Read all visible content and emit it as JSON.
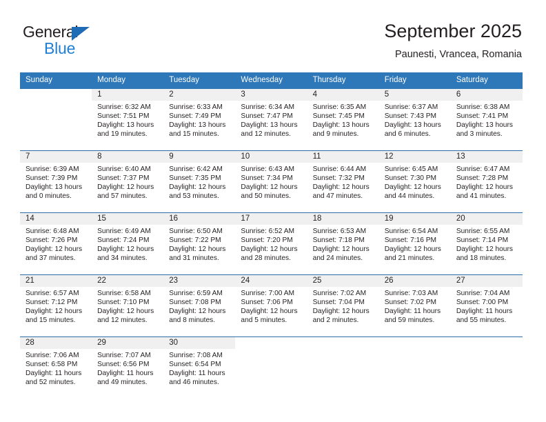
{
  "brand": {
    "name_top": "General",
    "name_bottom": "Blue",
    "triangle_color": "#1e6cb5",
    "blue_color": "#1f7fd4"
  },
  "header": {
    "title": "September 2025",
    "subtitle": "Paunesti, Vrancea, Romania"
  },
  "theme": {
    "header_blue": "#2e77b8",
    "row_divider": "#2b6ca8",
    "daynum_band": "#f0f0f0",
    "text": "#231f20"
  },
  "columns": [
    "Sunday",
    "Monday",
    "Tuesday",
    "Wednesday",
    "Thursday",
    "Friday",
    "Saturday"
  ],
  "labels": {
    "sunrise": "Sunrise:",
    "sunset": "Sunset:",
    "daylight": "Daylight:"
  },
  "weeks": [
    [
      {
        "day": "",
        "sunrise": "",
        "sunset": "",
        "daylight": ""
      },
      {
        "day": "1",
        "sunrise": "Sunrise: 6:32 AM",
        "sunset": "Sunset: 7:51 PM",
        "daylight": "Daylight: 13 hours and 19 minutes."
      },
      {
        "day": "2",
        "sunrise": "Sunrise: 6:33 AM",
        "sunset": "Sunset: 7:49 PM",
        "daylight": "Daylight: 13 hours and 15 minutes."
      },
      {
        "day": "3",
        "sunrise": "Sunrise: 6:34 AM",
        "sunset": "Sunset: 7:47 PM",
        "daylight": "Daylight: 13 hours and 12 minutes."
      },
      {
        "day": "4",
        "sunrise": "Sunrise: 6:35 AM",
        "sunset": "Sunset: 7:45 PM",
        "daylight": "Daylight: 13 hours and 9 minutes."
      },
      {
        "day": "5",
        "sunrise": "Sunrise: 6:37 AM",
        "sunset": "Sunset: 7:43 PM",
        "daylight": "Daylight: 13 hours and 6 minutes."
      },
      {
        "day": "6",
        "sunrise": "Sunrise: 6:38 AM",
        "sunset": "Sunset: 7:41 PM",
        "daylight": "Daylight: 13 hours and 3 minutes."
      }
    ],
    [
      {
        "day": "7",
        "sunrise": "Sunrise: 6:39 AM",
        "sunset": "Sunset: 7:39 PM",
        "daylight": "Daylight: 13 hours and 0 minutes."
      },
      {
        "day": "8",
        "sunrise": "Sunrise: 6:40 AM",
        "sunset": "Sunset: 7:37 PM",
        "daylight": "Daylight: 12 hours and 57 minutes."
      },
      {
        "day": "9",
        "sunrise": "Sunrise: 6:42 AM",
        "sunset": "Sunset: 7:35 PM",
        "daylight": "Daylight: 12 hours and 53 minutes."
      },
      {
        "day": "10",
        "sunrise": "Sunrise: 6:43 AM",
        "sunset": "Sunset: 7:34 PM",
        "daylight": "Daylight: 12 hours and 50 minutes."
      },
      {
        "day": "11",
        "sunrise": "Sunrise: 6:44 AM",
        "sunset": "Sunset: 7:32 PM",
        "daylight": "Daylight: 12 hours and 47 minutes."
      },
      {
        "day": "12",
        "sunrise": "Sunrise: 6:45 AM",
        "sunset": "Sunset: 7:30 PM",
        "daylight": "Daylight: 12 hours and 44 minutes."
      },
      {
        "day": "13",
        "sunrise": "Sunrise: 6:47 AM",
        "sunset": "Sunset: 7:28 PM",
        "daylight": "Daylight: 12 hours and 41 minutes."
      }
    ],
    [
      {
        "day": "14",
        "sunrise": "Sunrise: 6:48 AM",
        "sunset": "Sunset: 7:26 PM",
        "daylight": "Daylight: 12 hours and 37 minutes."
      },
      {
        "day": "15",
        "sunrise": "Sunrise: 6:49 AM",
        "sunset": "Sunset: 7:24 PM",
        "daylight": "Daylight: 12 hours and 34 minutes."
      },
      {
        "day": "16",
        "sunrise": "Sunrise: 6:50 AM",
        "sunset": "Sunset: 7:22 PM",
        "daylight": "Daylight: 12 hours and 31 minutes."
      },
      {
        "day": "17",
        "sunrise": "Sunrise: 6:52 AM",
        "sunset": "Sunset: 7:20 PM",
        "daylight": "Daylight: 12 hours and 28 minutes."
      },
      {
        "day": "18",
        "sunrise": "Sunrise: 6:53 AM",
        "sunset": "Sunset: 7:18 PM",
        "daylight": "Daylight: 12 hours and 24 minutes."
      },
      {
        "day": "19",
        "sunrise": "Sunrise: 6:54 AM",
        "sunset": "Sunset: 7:16 PM",
        "daylight": "Daylight: 12 hours and 21 minutes."
      },
      {
        "day": "20",
        "sunrise": "Sunrise: 6:55 AM",
        "sunset": "Sunset: 7:14 PM",
        "daylight": "Daylight: 12 hours and 18 minutes."
      }
    ],
    [
      {
        "day": "21",
        "sunrise": "Sunrise: 6:57 AM",
        "sunset": "Sunset: 7:12 PM",
        "daylight": "Daylight: 12 hours and 15 minutes."
      },
      {
        "day": "22",
        "sunrise": "Sunrise: 6:58 AM",
        "sunset": "Sunset: 7:10 PM",
        "daylight": "Daylight: 12 hours and 12 minutes."
      },
      {
        "day": "23",
        "sunrise": "Sunrise: 6:59 AM",
        "sunset": "Sunset: 7:08 PM",
        "daylight": "Daylight: 12 hours and 8 minutes."
      },
      {
        "day": "24",
        "sunrise": "Sunrise: 7:00 AM",
        "sunset": "Sunset: 7:06 PM",
        "daylight": "Daylight: 12 hours and 5 minutes."
      },
      {
        "day": "25",
        "sunrise": "Sunrise: 7:02 AM",
        "sunset": "Sunset: 7:04 PM",
        "daylight": "Daylight: 12 hours and 2 minutes."
      },
      {
        "day": "26",
        "sunrise": "Sunrise: 7:03 AM",
        "sunset": "Sunset: 7:02 PM",
        "daylight": "Daylight: 11 hours and 59 minutes."
      },
      {
        "day": "27",
        "sunrise": "Sunrise: 7:04 AM",
        "sunset": "Sunset: 7:00 PM",
        "daylight": "Daylight: 11 hours and 55 minutes."
      }
    ],
    [
      {
        "day": "28",
        "sunrise": "Sunrise: 7:06 AM",
        "sunset": "Sunset: 6:58 PM",
        "daylight": "Daylight: 11 hours and 52 minutes."
      },
      {
        "day": "29",
        "sunrise": "Sunrise: 7:07 AM",
        "sunset": "Sunset: 6:56 PM",
        "daylight": "Daylight: 11 hours and 49 minutes."
      },
      {
        "day": "30",
        "sunrise": "Sunrise: 7:08 AM",
        "sunset": "Sunset: 6:54 PM",
        "daylight": "Daylight: 11 hours and 46 minutes."
      },
      {
        "day": "",
        "sunrise": "",
        "sunset": "",
        "daylight": ""
      },
      {
        "day": "",
        "sunrise": "",
        "sunset": "",
        "daylight": ""
      },
      {
        "day": "",
        "sunrise": "",
        "sunset": "",
        "daylight": ""
      },
      {
        "day": "",
        "sunrise": "",
        "sunset": "",
        "daylight": ""
      }
    ]
  ]
}
